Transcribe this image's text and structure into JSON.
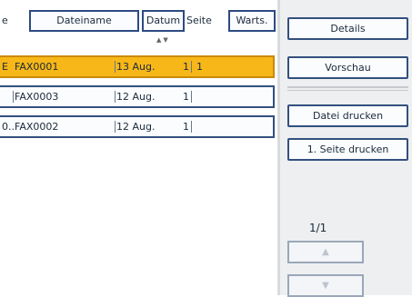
{
  "table": {
    "headers": {
      "prefix": "e",
      "name": "Dateiname",
      "date": "Datum",
      "pages": "Seite",
      "wait": "Warts."
    },
    "sort_indicator": "▲▼",
    "rows": [
      {
        "prefix": "E",
        "name": "FAX0001",
        "date": "13 Aug.",
        "pages": "1",
        "wait": "1",
        "selected": true
      },
      {
        "prefix": "",
        "name": "FAX0003",
        "date": "12 Aug.",
        "pages": "1",
        "wait": "",
        "selected": false
      },
      {
        "prefix": "0..",
        "name": "FAX0002",
        "date": "12 Aug.",
        "pages": "1",
        "wait": "",
        "selected": false
      }
    ]
  },
  "panel": {
    "details": "Details",
    "preview": "Vorschau",
    "print_file": "Datei drucken",
    "print_first": "1. Seite drucken",
    "page_indicator": "1/1",
    "up_glyph": "▲",
    "down_glyph": "▼"
  },
  "colors": {
    "selected_row": "#f7b718",
    "border": "#33507e",
    "panel_bg": "#edeff1"
  }
}
